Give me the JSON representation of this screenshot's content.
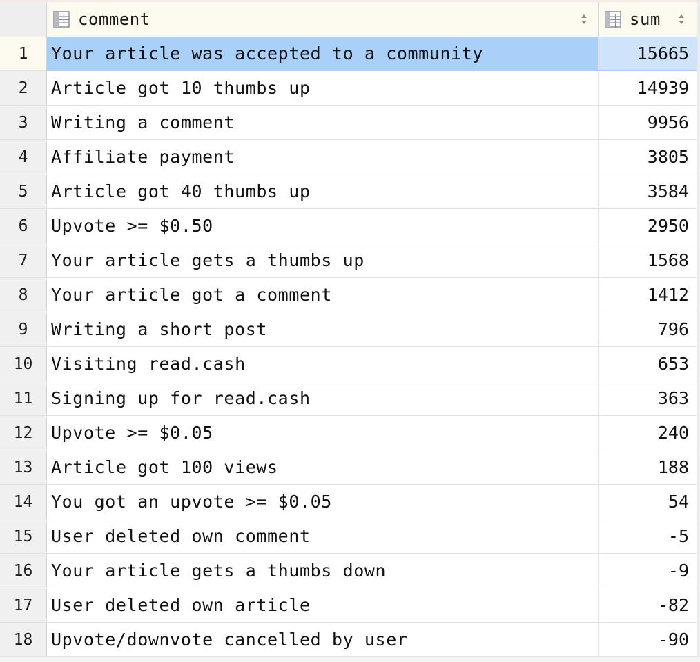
{
  "columns": [
    {
      "label": "comment",
      "icon": "table-column-icon",
      "sort_icon": "sort-arrows-icon"
    },
    {
      "label": "sum",
      "icon": "table-column-icon",
      "sort_icon": "sort-arrows-icon"
    }
  ],
  "selected_row": 1,
  "colors": {
    "selection": "#a9d0f8",
    "header_bg": "#fdfbef",
    "row_number_bg": "#f0f0f0"
  },
  "rows": [
    {
      "num": "1",
      "comment": "Your article was accepted to a community",
      "sum": "15665"
    },
    {
      "num": "2",
      "comment": "Article got 10 thumbs up",
      "sum": "14939"
    },
    {
      "num": "3",
      "comment": "Writing a comment",
      "sum": "9956"
    },
    {
      "num": "4",
      "comment": "Affiliate payment",
      "sum": "3805"
    },
    {
      "num": "5",
      "comment": "Article got 40 thumbs up",
      "sum": "3584"
    },
    {
      "num": "6",
      "comment": "Upvote >= $0.50",
      "sum": "2950"
    },
    {
      "num": "7",
      "comment": "Your article gets a thumbs up",
      "sum": "1568"
    },
    {
      "num": "8",
      "comment": "Your article got a comment",
      "sum": "1412"
    },
    {
      "num": "9",
      "comment": "Writing a short post",
      "sum": "796"
    },
    {
      "num": "10",
      "comment": "Visiting read.cash",
      "sum": "653"
    },
    {
      "num": "11",
      "comment": "Signing up for read.cash",
      "sum": "363"
    },
    {
      "num": "12",
      "comment": "Upvote >= $0.05",
      "sum": "240"
    },
    {
      "num": "13",
      "comment": "Article got 100 views",
      "sum": "188"
    },
    {
      "num": "14",
      "comment": "You got an upvote >= $0.05",
      "sum": "54"
    },
    {
      "num": "15",
      "comment": "User deleted own comment",
      "sum": "-5"
    },
    {
      "num": "16",
      "comment": "Your article gets a thumbs down",
      "sum": "-9"
    },
    {
      "num": "17",
      "comment": "User deleted own article",
      "sum": "-82"
    },
    {
      "num": "18",
      "comment": "Upvote/downvote cancelled by user",
      "sum": "-90"
    }
  ]
}
